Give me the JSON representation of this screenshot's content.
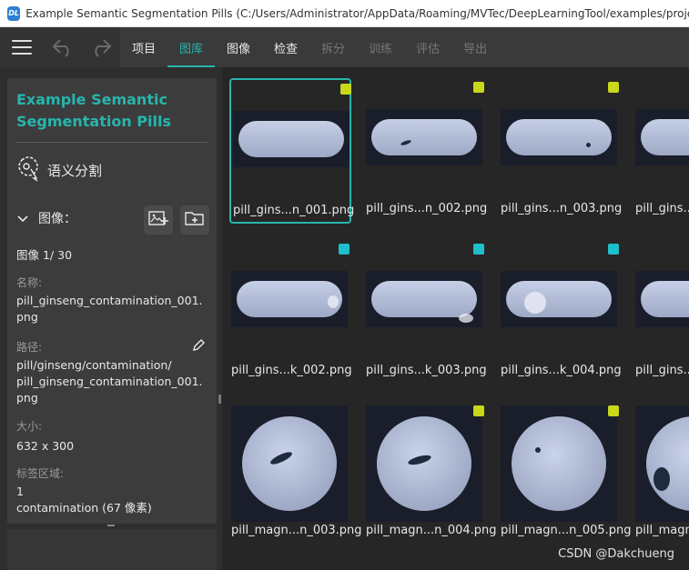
{
  "window": {
    "icon_text": "DL",
    "title": "Example Semantic Segmentation Pills (C:/Users/Administrator/AppData/Roaming/MVTec/DeepLearningTool/examples/projects/Example_S"
  },
  "toolbar": {
    "tabs": [
      {
        "label": "项目",
        "state": "normal"
      },
      {
        "label": "图库",
        "state": "active"
      },
      {
        "label": "图像",
        "state": "normal"
      },
      {
        "label": "检查",
        "state": "normal"
      },
      {
        "label": "拆分",
        "state": "disabled"
      },
      {
        "label": "训练",
        "state": "disabled"
      },
      {
        "label": "评估",
        "state": "disabled"
      },
      {
        "label": "导出",
        "state": "disabled"
      }
    ]
  },
  "sidebar": {
    "project_name": "Example Semantic Segmentation Pills",
    "method_label": "语义分割",
    "image_panel": {
      "title": "图像：",
      "counter": "图像 1/ 30",
      "name_label": "名称:",
      "name_value": "pill_ginseng_contamination_001.png",
      "path_label": "路径:",
      "path_value": "pill/ginseng/contamination/\npill_ginseng_contamination_001.png",
      "size_label": "大小:",
      "size_value": "632 x 300",
      "regions_label": "标签区域:",
      "regions_count": "1",
      "regions_detail": "contamination (67 像素)"
    }
  },
  "colors": {
    "accent": "#27b5ad",
    "tag_yellow": "#c9d81a",
    "tag_cyan": "#1fbecb"
  },
  "gallery": {
    "rows": [
      {
        "kind": "pill",
        "tiles": [
          {
            "name": "pill_gins...n_001.png",
            "tag": "yellow",
            "selected": true
          },
          {
            "name": "pill_gins...n_002.png",
            "tag": "yellow",
            "selected": false
          },
          {
            "name": "pill_gins...n_003.png",
            "tag": "yellow",
            "selected": false
          },
          {
            "name": "pill_gins...",
            "tag": "none",
            "selected": false
          }
        ]
      },
      {
        "kind": "pill",
        "tiles": [
          {
            "name": "pill_gins...k_002.png",
            "tag": "cyan",
            "selected": false
          },
          {
            "name": "pill_gins...k_003.png",
            "tag": "cyan",
            "selected": false
          },
          {
            "name": "pill_gins...k_004.png",
            "tag": "cyan",
            "selected": false
          },
          {
            "name": "pill_gins...",
            "tag": "none",
            "selected": false
          }
        ]
      },
      {
        "kind": "disc",
        "tiles": [
          {
            "name": "pill_magn...n_003.png",
            "tag": "none",
            "selected": false
          },
          {
            "name": "pill_magn...n_004.png",
            "tag": "yellow",
            "selected": false
          },
          {
            "name": "pill_magn...n_005.png",
            "tag": "yellow",
            "selected": false
          },
          {
            "name": "pill_magn",
            "tag": "none",
            "selected": false
          }
        ]
      }
    ]
  },
  "watermark": "CSDN @Dakchueng"
}
